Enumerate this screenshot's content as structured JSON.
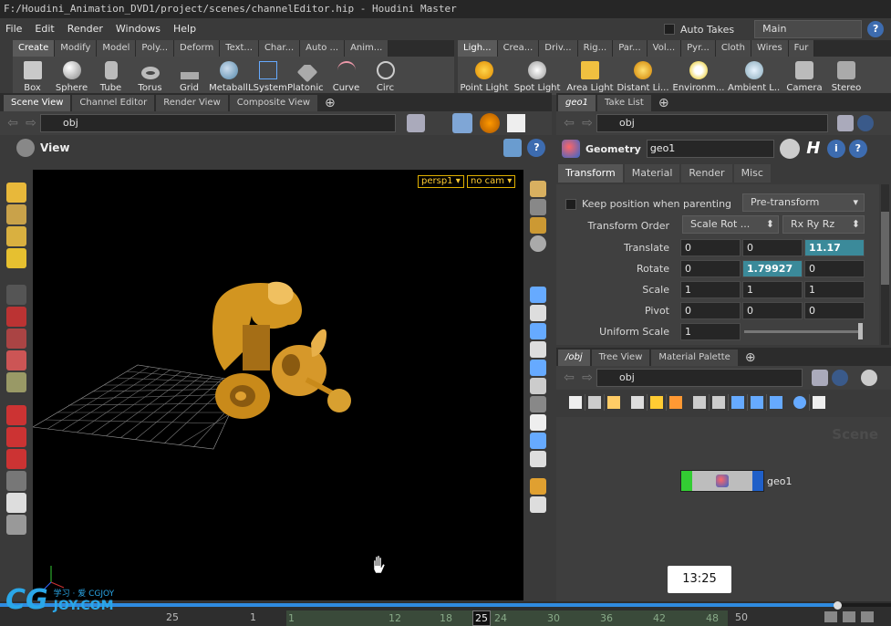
{
  "window": {
    "title": "F:/Houdini_Animation_DVD1/project/scenes/channelEditor.hip - Houdini Master"
  },
  "menu": [
    "File",
    "Edit",
    "Render",
    "Windows",
    "Help"
  ],
  "autotakes": {
    "label": "Auto Takes",
    "take": "Main"
  },
  "shelf_left": {
    "tabs": [
      "Create",
      "Modify",
      "Model",
      "Poly...",
      "Deform",
      "Text...",
      "Char...",
      "Auto ...",
      "Anim..."
    ],
    "tools": [
      "Box",
      "Sphere",
      "Tube",
      "Torus",
      "Grid",
      "Metaball",
      "LSystem",
      "Platonic ...",
      "Curve",
      "Circ"
    ]
  },
  "shelf_right": {
    "tabs": [
      "Ligh...",
      "Crea...",
      "Driv...",
      "Rig...",
      "Par...",
      "Vol...",
      "Pyr...",
      "Cloth",
      "Wires",
      "Fur"
    ],
    "tools": [
      "Point Light",
      "Spot Light",
      "Area Light",
      "Distant Li...",
      "Environm...",
      "Ambient L...",
      "Camera",
      "Stereo"
    ]
  },
  "scene": {
    "tabs": [
      "Scene View",
      "Channel Editor",
      "Render View",
      "Composite View"
    ],
    "path": "obj",
    "view_label": "View",
    "camera": "persp1",
    "nocam": "no cam"
  },
  "params": {
    "tabs_top": [
      "geo1",
      "Take List"
    ],
    "path": "obj",
    "node_type": "Geometry",
    "node_name": "geo1",
    "tabs": [
      "Transform",
      "Material",
      "Render",
      "Misc"
    ],
    "keep_position": "Keep position when parenting",
    "pre_transform": "Pre-transform",
    "transform_order_label": "Transform Order",
    "transform_order": "Scale Rot ...",
    "rot_order": "Rx Ry Rz",
    "rows": [
      {
        "label": "Translate",
        "values": [
          "0",
          "0",
          "11.17"
        ]
      },
      {
        "label": "Rotate",
        "values": [
          "0",
          "1.79927",
          "0"
        ]
      },
      {
        "label": "Scale",
        "values": [
          "1",
          "1",
          "1"
        ]
      },
      {
        "label": "Pivot",
        "values": [
          "0",
          "0",
          "0"
        ]
      }
    ],
    "uniform_scale_label": "Uniform Scale",
    "uniform_scale": "1"
  },
  "network": {
    "tabs": [
      "/obj",
      "Tree View",
      "Material Palette"
    ],
    "path": "obj",
    "watermark": "Scene",
    "node_label": "geo1"
  },
  "timeline": {
    "time_tooltip": "13:25",
    "frame": "25",
    "start": "1",
    "end": "50",
    "ticks": [
      "1",
      "12",
      "18",
      "24",
      "30",
      "36",
      "42",
      "48"
    ],
    "watermark_text": "JOY.COM",
    "watermark_cn": "学习 · 爱 CGJOY"
  },
  "progress": 0.94
}
